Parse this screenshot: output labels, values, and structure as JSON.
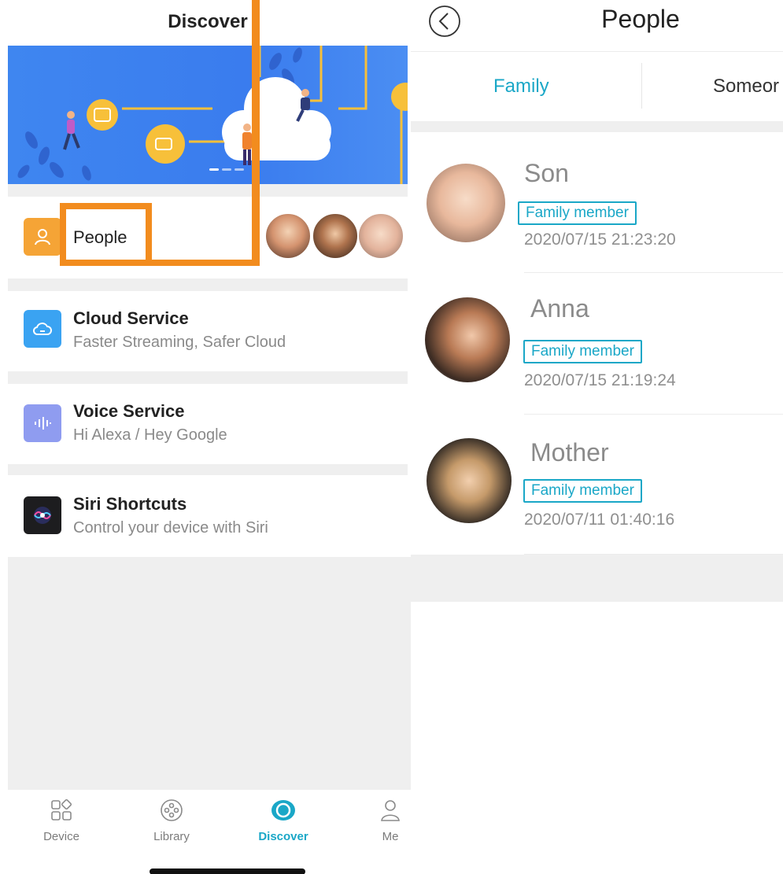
{
  "discover": {
    "title": "Discover",
    "people": {
      "label": "People"
    },
    "cloud": {
      "title": "Cloud Service",
      "subtitle": "Faster Streaming, Safer Cloud"
    },
    "voice": {
      "title": "Voice Service",
      "subtitle": "Hi Alexa / Hey Google"
    },
    "siri": {
      "title": "Siri Shortcuts",
      "subtitle": "Control your device with Siri"
    }
  },
  "tabbar": {
    "items": [
      {
        "label": "Device",
        "icon": "device-icon"
      },
      {
        "label": "Library",
        "icon": "library-icon"
      },
      {
        "label": "Discover",
        "icon": "discover-icon"
      },
      {
        "label": "Me",
        "icon": "me-icon"
      }
    ],
    "active": "Discover"
  },
  "people": {
    "title": "People",
    "tabs": {
      "family": "Family",
      "someone": "Someor"
    },
    "list": [
      {
        "name": "Son",
        "tag": "Family member",
        "date": "2020/07/15 21:23:20"
      },
      {
        "name": "Anna",
        "tag": "Family member",
        "date": "2020/07/15 21:19:24"
      },
      {
        "name": "Mother",
        "tag": "Family member",
        "date": "2020/07/11 01:40:16"
      }
    ]
  },
  "colors": {
    "accent": "#1aa7c7",
    "highlight": "#f28c1e",
    "banner": "#3f86f0",
    "background": "#efefef"
  }
}
